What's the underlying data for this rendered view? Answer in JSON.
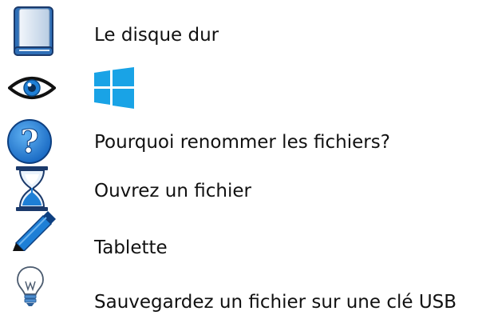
{
  "items": [
    {
      "icon": "book-icon",
      "label": "Le disque dur"
    },
    {
      "icon": "eye-icon",
      "secondary_icon": "windows-logo-icon",
      "label": ""
    },
    {
      "icon": "question-mark-icon",
      "label": "Pourquoi renommer les fichiers?"
    },
    {
      "icon": "hourglass-icon",
      "label": "Ouvrez un fichier"
    },
    {
      "icon": "pencil-icon",
      "label": "Tablette"
    },
    {
      "icon": "lightbulb-icon",
      "label": "Sauvegardez un fichier sur une clé USB"
    }
  ],
  "colors": {
    "blue": "#1e7fd6",
    "dark_blue": "#1b3a6b",
    "light_blue": "#cfe3f5",
    "windows_blue": "#19a3e6",
    "text": "#111111"
  }
}
